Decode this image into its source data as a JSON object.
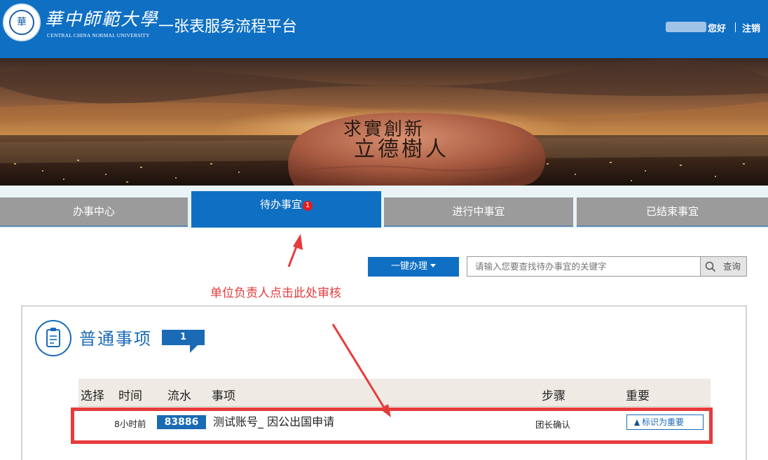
{
  "header": {
    "university_cn": "華中師範大學",
    "university_en": "CENTRAL CHINA NORMAL UNIVERSITY",
    "seal_text": "華",
    "platform_title": "一张表服务流程平台",
    "greeting": "您好",
    "logout": "注销"
  },
  "banner": {
    "stone_line1": "求實創新",
    "stone_line2": "立德樹人"
  },
  "tabs": [
    {
      "label": "办事中心",
      "active": false
    },
    {
      "label": "待办事宜",
      "active": true,
      "badge": "1"
    },
    {
      "label": "进行中事宜",
      "active": false
    },
    {
      "label": "已结束事宜",
      "active": false
    }
  ],
  "toolbar": {
    "one_click_label": "一键办理",
    "search_placeholder": "请输入您要查找待办事宜的关键字",
    "search_button": "查询"
  },
  "annotation": {
    "text": "单位负责人点击此处审核",
    "color": "#e23a3a"
  },
  "section": {
    "title": "普通事项",
    "count": "1"
  },
  "table": {
    "headers": [
      "选择",
      "时间",
      "流水",
      "事项",
      "步骤",
      "重要"
    ],
    "rows": [
      {
        "time": "8小时前",
        "serial": "83886",
        "item": "测试账号_ 因公出国申请",
        "step": "团长确认",
        "mark_label": "标识为重要"
      }
    ]
  },
  "colors": {
    "brand_blue": "#0f6fc3",
    "tab_inactive": "#9b9b9b",
    "annotation_red": "#e63b3b"
  }
}
